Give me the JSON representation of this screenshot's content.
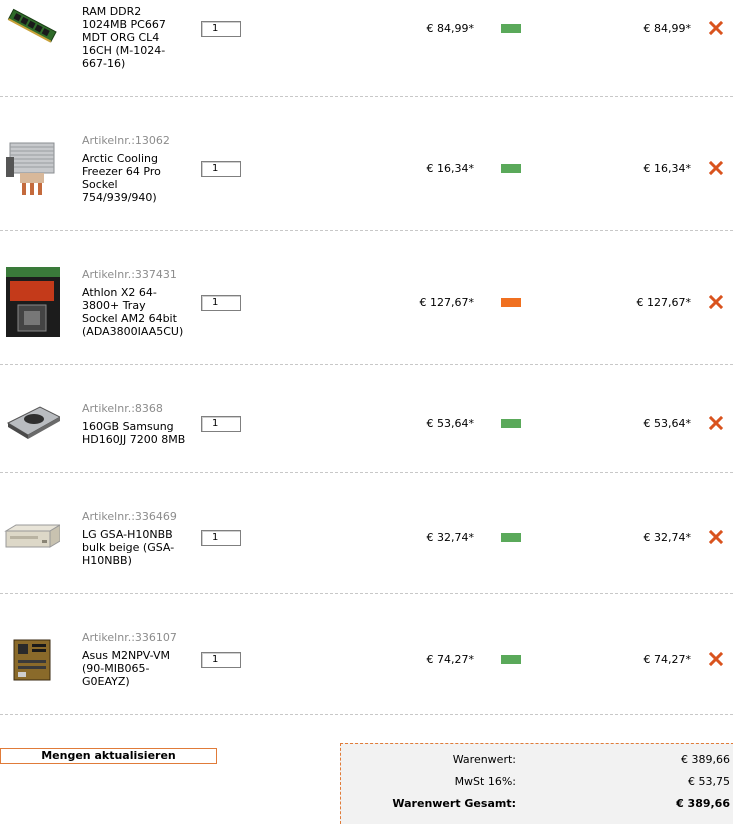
{
  "cart": {
    "items": [
      {
        "article_number": "",
        "name": "RAM DDR2\n1024MB PC667\nMDT ORG CL4\n16CH (M-1024-\n667-16)",
        "quantity": "1",
        "unit_price": "€ 84,99*",
        "availability_color": "#5aa95a",
        "total_price": "€ 84,99*",
        "thumbnail_icon": "ram-module-icon"
      },
      {
        "article_number": "Artikelnr.:13062",
        "name": "Arctic Cooling\nFreezer 64 Pro\nSockel\n754/939/940)",
        "quantity": "1",
        "unit_price": "€ 16,34*",
        "availability_color": "#5aa95a",
        "total_price": "€ 16,34*",
        "thumbnail_icon": "cpu-cooler-icon"
      },
      {
        "article_number": "Artikelnr.:337431",
        "name": "Athlon X2 64-\n3800+ Tray\nSockel AM2 64bit\n(ADA3800IAA5CU)",
        "quantity": "1",
        "unit_price": "€ 127,67*",
        "availability_color": "#f07020",
        "total_price": "€ 127,67*",
        "thumbnail_icon": "cpu-box-icon"
      },
      {
        "article_number": "Artikelnr.:8368",
        "name": "160GB Samsung\nHD160JJ 7200 8MB",
        "quantity": "1",
        "unit_price": "€ 53,64*",
        "availability_color": "#5aa95a",
        "total_price": "€ 53,64*",
        "thumbnail_icon": "hard-drive-icon"
      },
      {
        "article_number": "Artikelnr.:336469",
        "name": "LG GSA-H10NBB\nbulk beige (GSA-\nH10NBB)",
        "quantity": "1",
        "unit_price": "€ 32,74*",
        "availability_color": "#5aa95a",
        "total_price": "€ 32,74*",
        "thumbnail_icon": "optical-drive-icon"
      },
      {
        "article_number": "Artikelnr.:336107",
        "name": "Asus M2NPV-VM\n(90-MIB065-\nG0EAYZ)",
        "quantity": "1",
        "unit_price": "€ 74,27*",
        "availability_color": "#5aa95a",
        "total_price": "€ 74,27*",
        "thumbnail_icon": "motherboard-icon"
      }
    ],
    "remove_icon": "remove-x-icon",
    "update_button_label": "Mengen aktualisieren"
  },
  "summary": {
    "subtotal_label": "Warenwert:",
    "subtotal_value": "€ 389,66",
    "tax_label": "MwSt 16%:",
    "tax_value": "€ 53,75",
    "grand_total_label": "Warenwert Gesamt:",
    "grand_total_value": "€ 389,66"
  },
  "colors": {
    "accent_orange": "#e07b39",
    "remove_icon_red": "#d9531e",
    "available_green": "#5aa95a",
    "limited_orange": "#f07020"
  }
}
